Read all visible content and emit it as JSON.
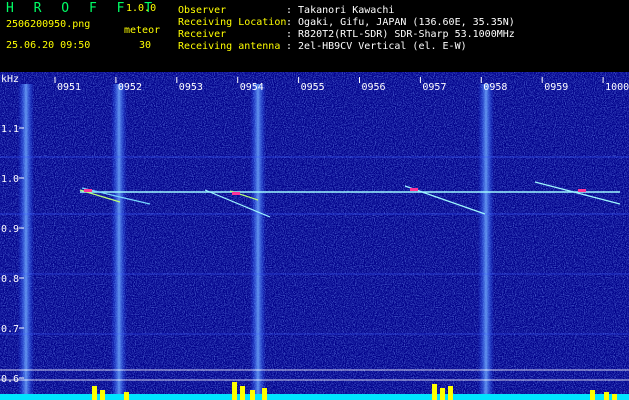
{
  "header": {
    "app_name": "H R O F F T",
    "version": "1.0.0",
    "filename": "2506200950.png",
    "count_label": "meteor",
    "timestamp": "25.06.20 09:50",
    "count_value": "30",
    "info": [
      {
        "label": "Observer",
        "value": ": Takanori Kawachi"
      },
      {
        "label": "Receiving Location",
        "value": ": Ogaki, Gifu, JAPAN (136.60E, 35.35N)"
      },
      {
        "label": "Receiver",
        "value": ": R820T2(RTL-SDR) SDR-Sharp 53.1000MHz"
      },
      {
        "label": "Receiving antenna",
        "value": ": 2el-HB9CV Vertical (el. E-W)"
      }
    ]
  },
  "spectrogram": {
    "y_unit": "kHz",
    "y_ticks": [
      "1.1",
      "1.0",
      "0.9",
      "0.8",
      "0.7",
      "0.6"
    ],
    "x_ticks": [
      "0951",
      "0952",
      "0953",
      "0954",
      "0955",
      "0956",
      "0957",
      "0958",
      "0959",
      "1000"
    ],
    "colors": {
      "background": "#00008a",
      "label": "#ffffff",
      "signal": "#9ef7ff",
      "meteor": "#ff3399",
      "level": "#ffff00",
      "baseline": "#00e5ff"
    }
  }
}
